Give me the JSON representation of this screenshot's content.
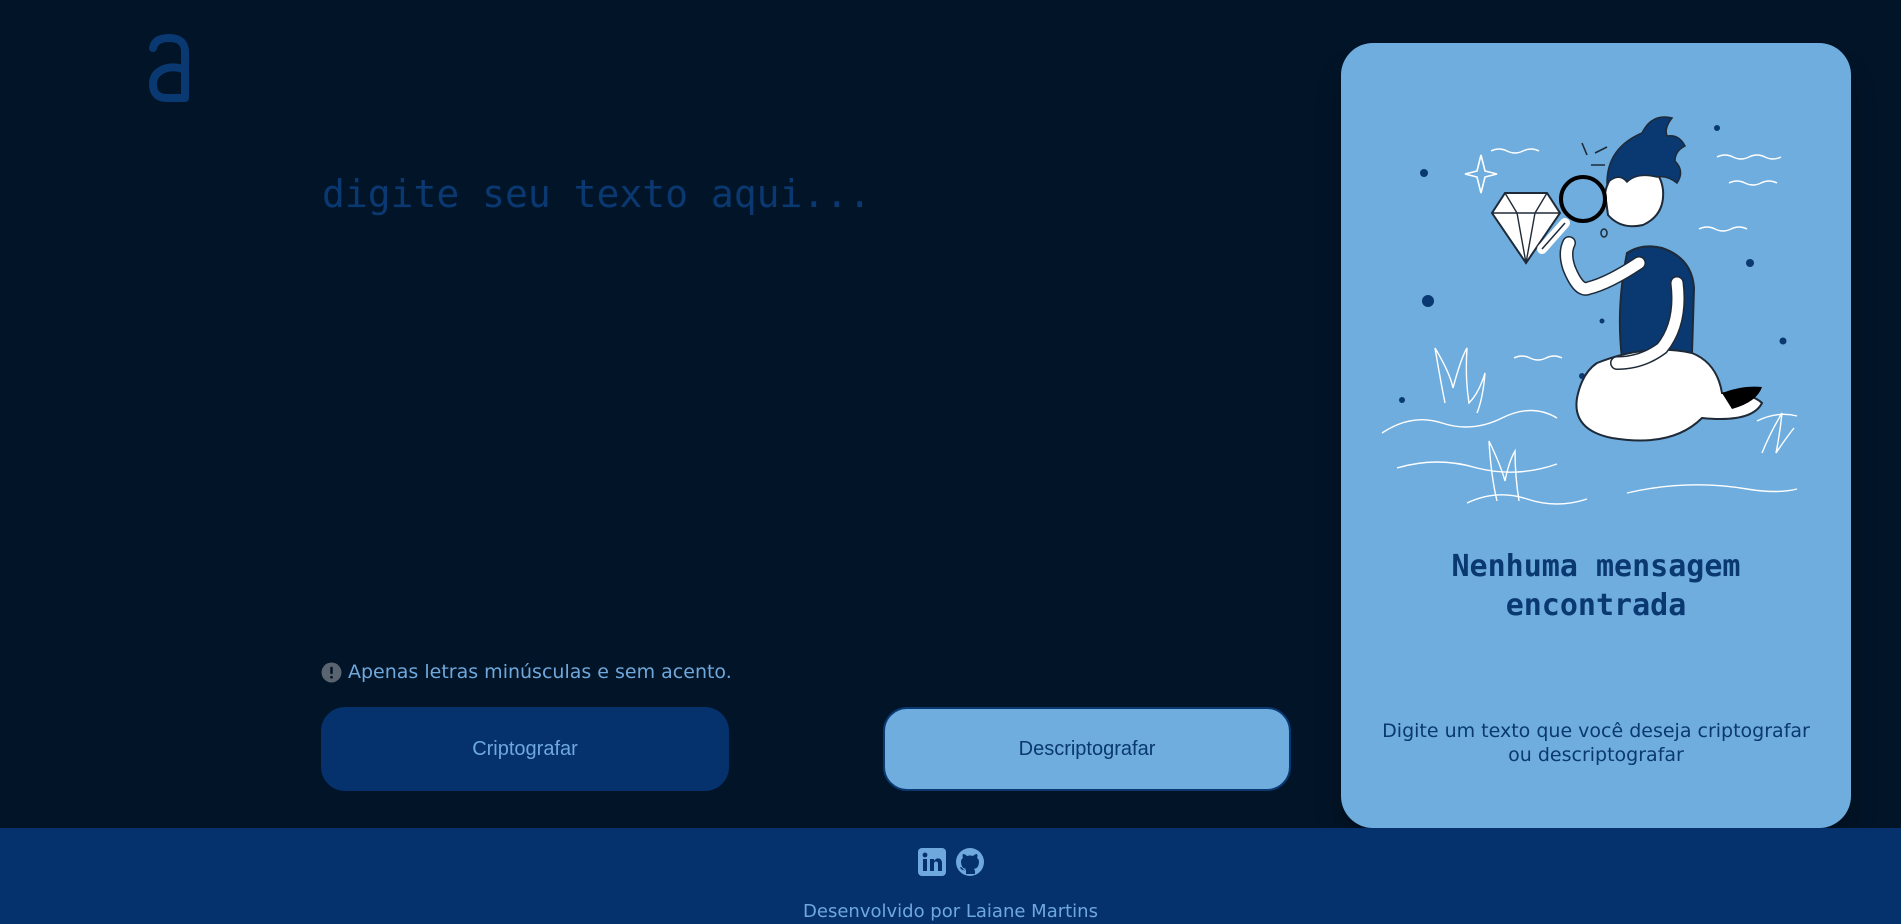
{
  "logo": {
    "icon": "alura-a-logo-icon",
    "color": "#0a3871"
  },
  "input": {
    "placeholder": "digite seu texto aqui..."
  },
  "hint": {
    "icon": "exclamation-circle-icon",
    "text": "Apenas letras minúsculas e sem acento."
  },
  "buttons": {
    "encrypt_label": "Criptografar",
    "decrypt_label": "Descriptografar"
  },
  "output_panel": {
    "illustration": "person-with-magnifying-glass-illustration",
    "title": "Nenhuma mensagem encontrada",
    "description": "Digite um texto que você deseja criptografar ou descriptografar"
  },
  "footer": {
    "social": [
      {
        "icon": "linkedin-icon"
      },
      {
        "icon": "github-icon"
      }
    ],
    "credit": "Desenvolvido por Laiane Martins"
  },
  "colors": {
    "background": "#021427",
    "accent_dark": "#0a3871",
    "accent_light": "#6fadde",
    "footer": "#05316c"
  }
}
